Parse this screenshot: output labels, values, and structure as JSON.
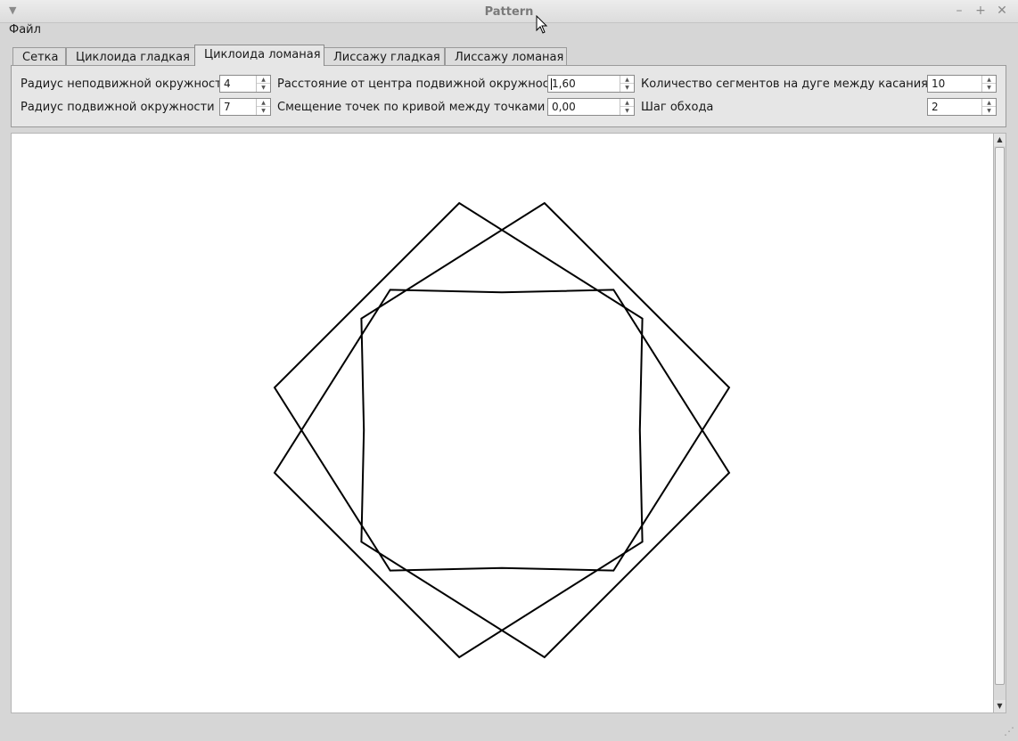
{
  "window": {
    "title": "Pattern"
  },
  "menu": {
    "file": "Файл"
  },
  "tabs": [
    {
      "label": "Сетка"
    },
    {
      "label": "Циклоида гладкая"
    },
    {
      "label": "Циклоида ломаная"
    },
    {
      "label": "Лиссажу гладкая"
    },
    {
      "label": "Лиссажу ломаная"
    }
  ],
  "active_tab": "Циклоида ломаная",
  "params": {
    "fixed_radius_label": "Радиус неподвижной окружности",
    "fixed_radius_value": "4",
    "moving_radius_label": "Радиус подвижной окружности",
    "moving_radius_value": "7",
    "distance_label": "Расстояние от центра подвижной окружности",
    "distance_value": "1,60",
    "offset_label": "Смещение точек по кривой между точками",
    "offset_value": "0,00",
    "segments_label": "Количество сегментов на дуге между касаниями",
    "segments_value": "10",
    "step_label": "Шаг обхода",
    "step_value": "2"
  },
  "colors": {
    "stroke": "#000000",
    "canvas": "#ffffff"
  },
  "icons": {
    "minimize": "minimize-icon",
    "maximize": "maximize-icon",
    "close": "close-icon"
  }
}
